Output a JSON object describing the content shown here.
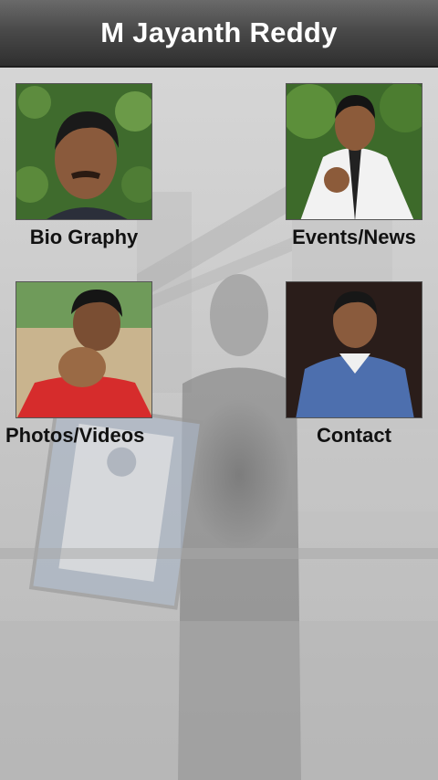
{
  "app": {
    "title": "M Jayanth Reddy"
  },
  "tiles": [
    {
      "label": "Bio Graphy",
      "icon": "portrait-photo-icon"
    },
    {
      "label": "Events/News",
      "icon": "karate-photo-icon"
    },
    {
      "label": "Photos/Videos",
      "icon": "punch-photo-icon"
    },
    {
      "label": "Contact",
      "icon": "contact-photo-icon"
    }
  ],
  "colors": {
    "titlebar": "#3c3c3c",
    "title_text": "#ffffff",
    "label_text": "#111111"
  }
}
